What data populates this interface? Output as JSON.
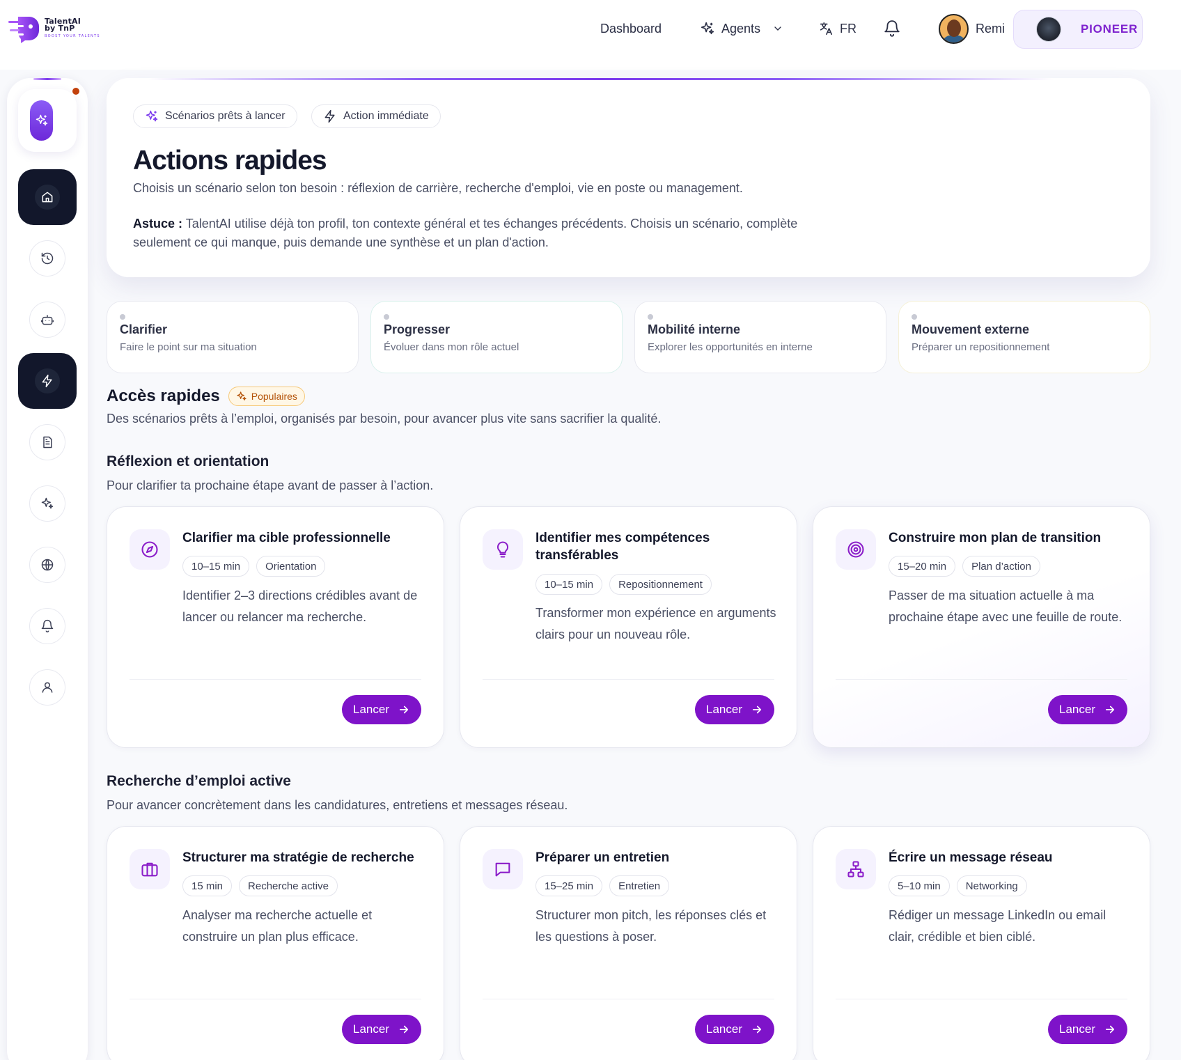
{
  "brand": {
    "name": "TalentAI\nby TnP",
    "tagline": "BOOST YOUR TALENTS",
    "accent": "#7e13c9"
  },
  "topnav": {
    "dashboard": "Dashboard",
    "agents": "Agents",
    "lang": "FR",
    "user_name": "Remi",
    "plan": "PIONEER"
  },
  "sidebar": {
    "items": [
      "sparkles-icon",
      "home-icon",
      "history-icon",
      "bot-icon",
      "zap-icon",
      "document-icon",
      "sparkles-icon",
      "globe-icon",
      "bell-icon",
      "user-icon"
    ],
    "active": [
      "home-icon",
      "zap-icon"
    ]
  },
  "hero": {
    "chip1": "Scénarios prêts à lancer",
    "chip2": "Action immédiate",
    "title": "Actions rapides",
    "subtitle": "Choisis un scénario selon ton besoin : réflexion de carrière, recherche d'emploi, vie en poste ou management.",
    "tip_label": "Astuce :",
    "tip_text": "TalentAI utilise déjà ton profil, ton contexte général et tes échanges précédents. Choisis un scénario, complète seulement ce qui manque, puis demande une synthèse et un plan d'action."
  },
  "needs": [
    {
      "title": "Clarifier",
      "subtitle": "Faire le point sur ma situation"
    },
    {
      "title": "Progresser",
      "subtitle": "Évoluer dans mon rôle actuel"
    },
    {
      "title": "Mobilité interne",
      "subtitle": "Explorer les opportunités en interne"
    },
    {
      "title": "Mouvement externe",
      "subtitle": "Préparer un repositionnement"
    }
  ],
  "quick_access": {
    "title": "Accès rapides",
    "badge": "Populaires",
    "subtitle": "Des scénarios prêts à l’emploi, organisés par besoin, pour avancer plus vite sans sacrifier la qualité."
  },
  "groups": [
    {
      "title": "Réflexion et orientation",
      "subtitle": "Pour clarifier ta prochaine étape avant de passer à l’action.",
      "cards": [
        {
          "icon": "compass-icon",
          "title": "Clarifier ma cible professionnelle",
          "duration": "10–15 min",
          "tag": "Orientation",
          "desc": "Identifier 2–3 directions crédibles avant de lancer ou relancer ma recherche.",
          "action": "Lancer"
        },
        {
          "icon": "lightbulb-icon",
          "title": "Identifier mes compétences transférables",
          "duration": "10–15 min",
          "tag": "Repositionnement",
          "desc": "Transformer mon expérience en arguments clairs pour un nouveau rôle.",
          "action": "Lancer"
        },
        {
          "icon": "target-icon",
          "title": "Construire mon plan de transition",
          "duration": "15–20 min",
          "tag": "Plan d’action",
          "desc": "Passer de ma situation actuelle à ma prochaine étape avec une feuille de route.",
          "action": "Lancer"
        }
      ]
    },
    {
      "title": "Recherche d’emploi active",
      "subtitle": "Pour avancer concrètement dans les candidatures, entretiens et messages réseau.",
      "cards": [
        {
          "icon": "briefcase-icon",
          "title": "Structurer ma stratégie de recherche",
          "duration": "15 min",
          "tag": "Recherche active",
          "desc": "Analyser ma recherche actuelle et construire un plan plus efficace.",
          "action": "Lancer"
        },
        {
          "icon": "chat-icon",
          "title": "Préparer un entretien",
          "duration": "15–25 min",
          "tag": "Entretien",
          "desc": "Structurer mon pitch, les réponses clés et les questions à poser.",
          "action": "Lancer"
        },
        {
          "icon": "network-icon",
          "title": "Écrire un message réseau",
          "duration": "5–10 min",
          "tag": "Networking",
          "desc": "Rédiger un message LinkedIn ou email clair, crédible et bien ciblé.",
          "action": "Lancer"
        }
      ]
    }
  ]
}
